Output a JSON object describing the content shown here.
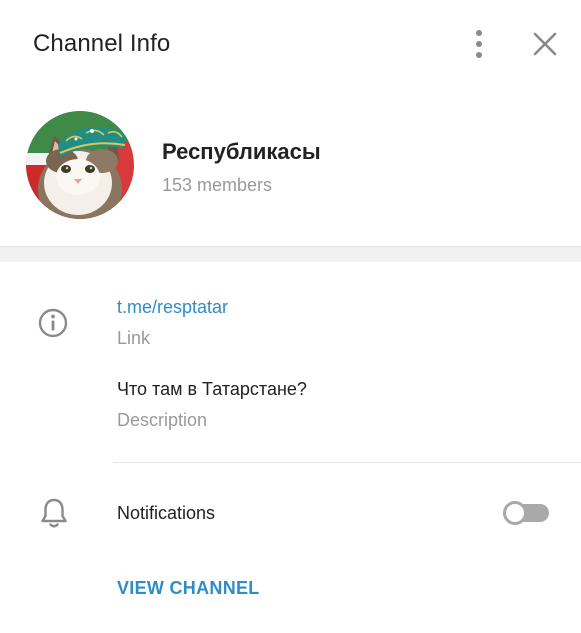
{
  "header": {
    "title": "Channel Info",
    "menu_icon": "more-vertical-icon",
    "close_icon": "close-icon"
  },
  "channel": {
    "name": "Республикасы",
    "members": "153 members",
    "avatar": "cat-in-tatar-skullcap-avatar"
  },
  "info": {
    "icon": "info-icon",
    "link_value": "t.me/resptatar",
    "link_label": "Link",
    "description_value": "Что там в Татарстане?",
    "description_label": "Description"
  },
  "notifications": {
    "icon": "bell-icon",
    "label": "Notifications",
    "enabled": false
  },
  "actions": {
    "view_channel": "VIEW CHANNEL"
  },
  "colors": {
    "accent": "#2f8cc9",
    "secondary_text": "#999999",
    "icon": "#8a8a8a"
  }
}
